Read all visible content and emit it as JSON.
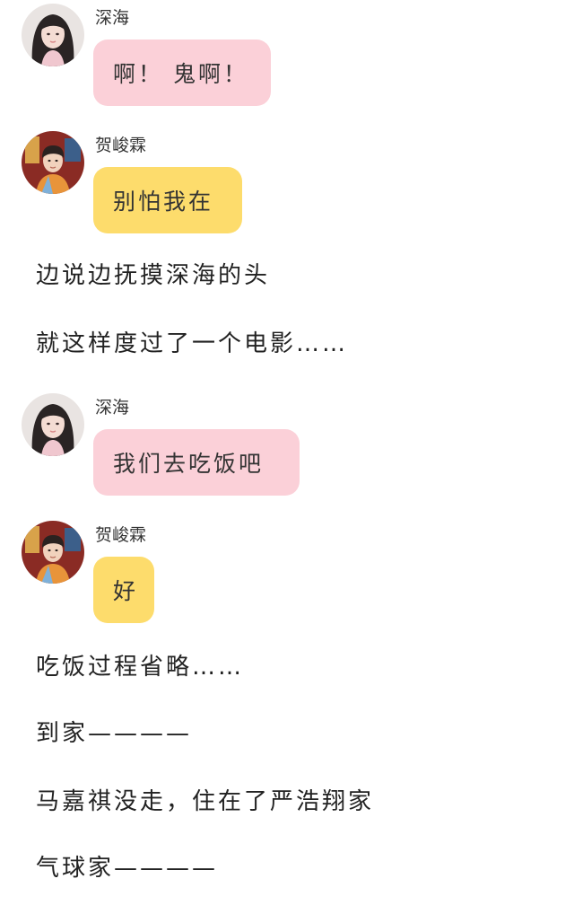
{
  "conversation": [
    {
      "kind": "message",
      "speaker": "深海",
      "avatar_icon": "girl-avatar-icon",
      "bubble_color": "#fbd0d8",
      "text": "啊！ 鬼啊！"
    },
    {
      "kind": "message",
      "speaker": "贺峻霖",
      "avatar_icon": "boy-avatar-icon",
      "bubble_color": "#fddc6c",
      "text": "别怕我在"
    },
    {
      "kind": "narration",
      "text": "边说边抚摸深海的头"
    },
    {
      "kind": "narration",
      "text": "就这样度过了一个电影……"
    },
    {
      "kind": "message",
      "speaker": "深海",
      "avatar_icon": "girl-avatar-icon",
      "bubble_color": "#fbd0d8",
      "text": "我们去吃饭吧"
    },
    {
      "kind": "message",
      "speaker": "贺峻霖",
      "avatar_icon": "boy-avatar-icon",
      "bubble_color": "#fddc6c",
      "text": "好"
    },
    {
      "kind": "narration",
      "text": "吃饭过程省略……"
    },
    {
      "kind": "narration",
      "text": "到家————"
    },
    {
      "kind": "narration",
      "text": "马嘉祺没走，住在了严浩翔家"
    },
    {
      "kind": "narration",
      "text": "气球家————"
    }
  ]
}
